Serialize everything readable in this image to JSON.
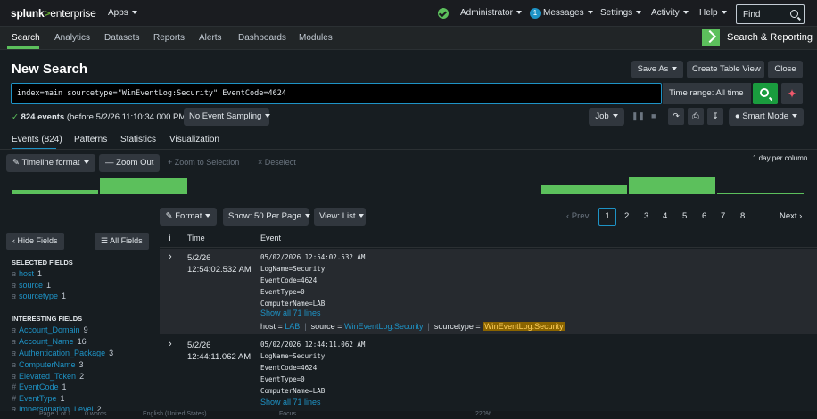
{
  "topbar": {
    "logo_left": "splunk",
    "logo_sep": ">",
    "logo_right": "enterprise",
    "apps": "Apps",
    "user": "Administrator",
    "messages_count": "1",
    "messages": "Messages",
    "settings": "Settings",
    "activity": "Activity",
    "help": "Help",
    "find_placeholder": "Find"
  },
  "appnav": {
    "items": [
      "Search",
      "Analytics",
      "Datasets",
      "Reports",
      "Alerts",
      "Dashboards",
      "Modules"
    ],
    "app_title": "Search & Reporting"
  },
  "page": {
    "title": "New Search",
    "save_as": "Save As",
    "create_table_view": "Create Table View",
    "close": "Close"
  },
  "search": {
    "query": "index=main sourcetype=\"WinEventLog:Security\" EventCode=4624",
    "time_range": "Time range: All time",
    "ai_icon": "sparkle-icon"
  },
  "status": {
    "events": "824 events",
    "before": "(before 5/2/26 11:10:34.000 PM)",
    "sampling": "No Event Sampling",
    "job": "Job",
    "smart_mode": "Smart Mode"
  },
  "tabs": [
    "Events (824)",
    "Patterns",
    "Statistics",
    "Visualization"
  ],
  "timeline": {
    "format": "Timeline format",
    "zoom_out": "Zoom Out",
    "zoom_selection": "+ Zoom to Selection",
    "deselect": "× Deselect",
    "scale": "1 day per column"
  },
  "results_toolbar": {
    "format": "Format",
    "per_page": "Show: 50 Per Page",
    "view": "View: List",
    "prev": "‹ Prev",
    "pages": [
      "1",
      "2",
      "3",
      "4",
      "5",
      "6",
      "7",
      "8"
    ],
    "ellipsis": "...",
    "next": "Next ›"
  },
  "sidebar": {
    "hide_fields": "Hide Fields",
    "all_fields": "All Fields",
    "selected_heading": "SELECTED FIELDS",
    "selected": [
      {
        "type": "a",
        "name": "host",
        "count": "1"
      },
      {
        "type": "a",
        "name": "source",
        "count": "1"
      },
      {
        "type": "a",
        "name": "sourcetype",
        "count": "1"
      }
    ],
    "interesting_heading": "INTERESTING FIELDS",
    "interesting": [
      {
        "type": "a",
        "name": "Account_Domain",
        "count": "9"
      },
      {
        "type": "a",
        "name": "Account_Name",
        "count": "16"
      },
      {
        "type": "a",
        "name": "Authentication_Package",
        "count": "3"
      },
      {
        "type": "a",
        "name": "ComputerName",
        "count": "3"
      },
      {
        "type": "a",
        "name": "Elevated_Token",
        "count": "2"
      },
      {
        "type": "#",
        "name": "EventCode",
        "count": "1"
      },
      {
        "type": "#",
        "name": "EventType",
        "count": "1"
      },
      {
        "type": "a",
        "name": "Impersonation_Level",
        "count": "2"
      }
    ]
  },
  "table": {
    "col_info": "i",
    "col_time": "Time",
    "col_event": "Event"
  },
  "events": [
    {
      "date": "5/2/26",
      "time": "12:54:02.532 AM",
      "lines": [
        "05/02/2026 12:54:02.532 AM",
        "LogName=Security",
        "EventCode=4624",
        "EventType=0",
        "ComputerName=LAB"
      ],
      "show_all": "Show all 71 lines",
      "host_label": "host =",
      "host": "LAB",
      "source_label": "source =",
      "source": "WinEventLog:Security",
      "sourcetype_label": "sourcetype =",
      "sourcetype": "WinEventLog:Security"
    },
    {
      "date": "5/2/26",
      "time": "12:44:11.062 AM",
      "lines": [
        "05/02/2026 12:44:11.062 AM",
        "LogName=Security",
        "EventCode=4624",
        "EventType=0",
        "ComputerName=LAB"
      ],
      "show_all": "Show all 71 lines"
    }
  ],
  "bottom_bar": {
    "page": "Page 1 of 1",
    "words": "0 words",
    "lang": "English (United States)",
    "focus": "Focus",
    "zoom": "220%"
  },
  "colors": {
    "accent": "#1e93c6",
    "success": "#5cc05c",
    "highlight": "#8a6400"
  }
}
